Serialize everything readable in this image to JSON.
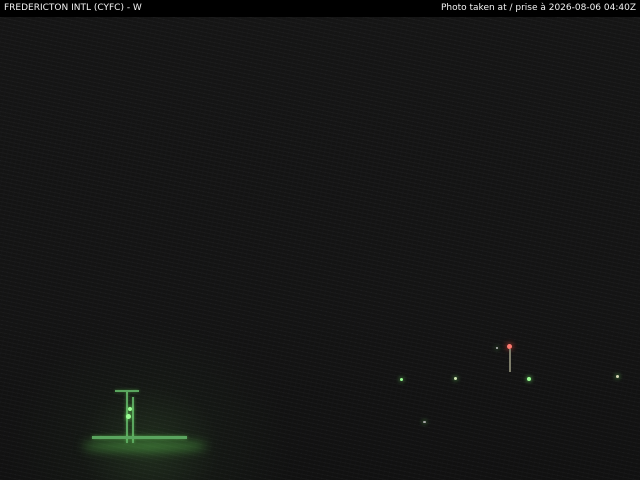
{
  "header": {
    "title": "FREDERICTON INTL (CYFC) - W",
    "timestamp": "Photo taken at / prise à 2026-08-06 04:40Z"
  },
  "scene": {
    "description_icons": [
      "runway-light-icon",
      "tower-light-icon",
      "obstruction-light-icon"
    ],
    "colors": {
      "background": "#121212",
      "header": "#000000",
      "green_lights": "#9cff96",
      "red_light": "#ff7a70"
    }
  }
}
